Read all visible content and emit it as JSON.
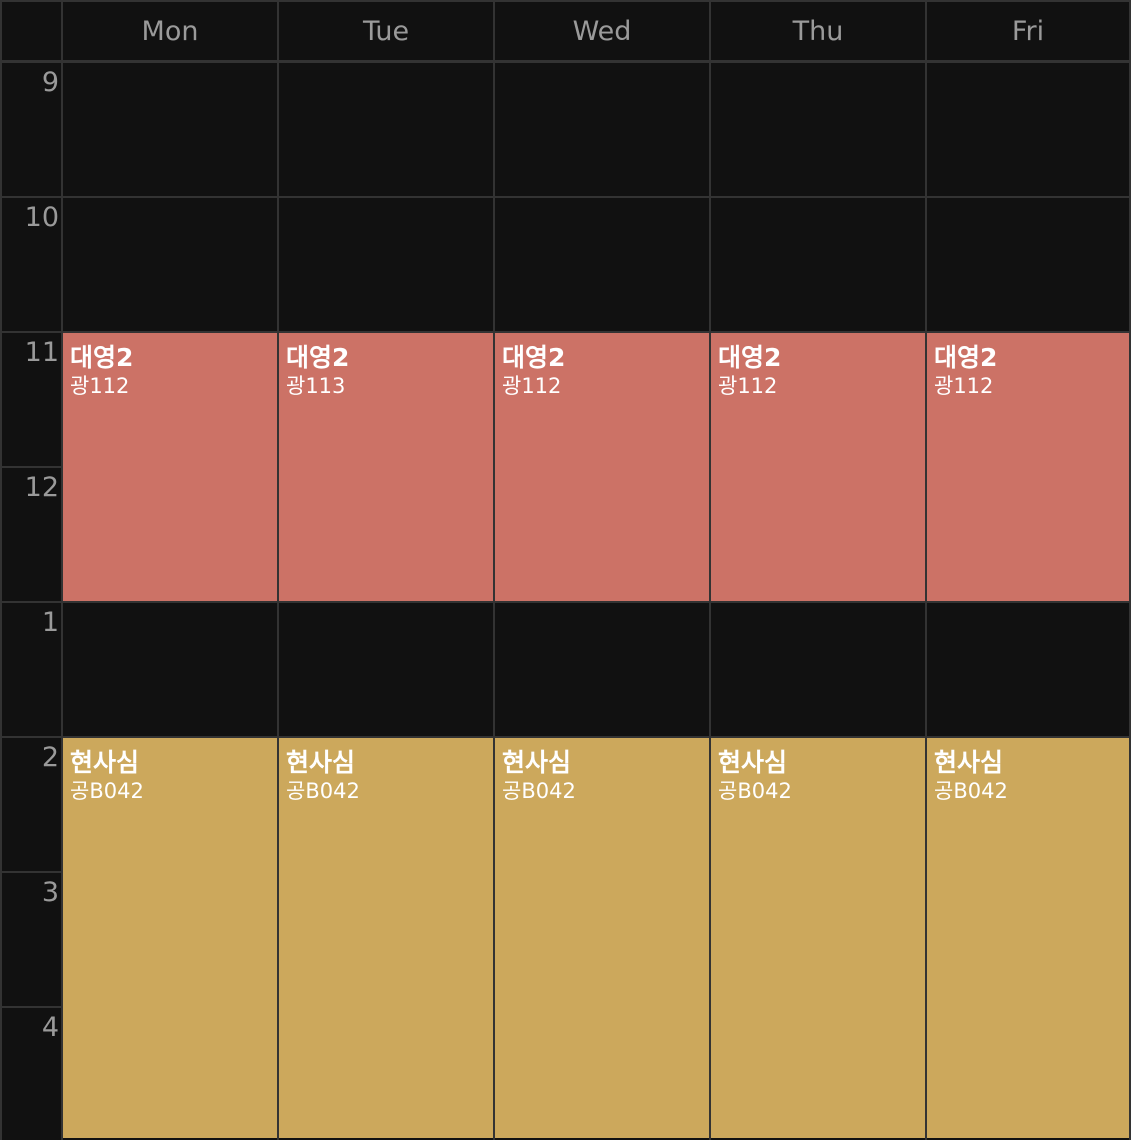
{
  "days": [
    "Mon",
    "Tue",
    "Wed",
    "Thu",
    "Fri"
  ],
  "hours": [
    "9",
    "10",
    "11",
    "12",
    "1",
    "2",
    "3",
    "4"
  ],
  "colors": {
    "background": "#111111",
    "grid_line": "#333333",
    "label_text": "#9a9a9a",
    "event_red": "#cc7266",
    "event_gold": "#cca85c"
  },
  "events": [
    {
      "day": 0,
      "start_hour_index": 2,
      "hours": 2,
      "title": "대영2",
      "room": "광112",
      "color": "#cc7266"
    },
    {
      "day": 1,
      "start_hour_index": 2,
      "hours": 2,
      "title": "대영2",
      "room": "광113",
      "color": "#cc7266"
    },
    {
      "day": 2,
      "start_hour_index": 2,
      "hours": 2,
      "title": "대영2",
      "room": "광112",
      "color": "#cc7266"
    },
    {
      "day": 3,
      "start_hour_index": 2,
      "hours": 2,
      "title": "대영2",
      "room": "광112",
      "color": "#cc7266"
    },
    {
      "day": 4,
      "start_hour_index": 2,
      "hours": 2,
      "title": "대영2",
      "room": "광112",
      "color": "#cc7266"
    },
    {
      "day": 0,
      "start_hour_index": 5,
      "hours": 3,
      "title": "현사심",
      "room": "공B042",
      "color": "#cca85c"
    },
    {
      "day": 1,
      "start_hour_index": 5,
      "hours": 3,
      "title": "현사심",
      "room": "공B042",
      "color": "#cca85c"
    },
    {
      "day": 2,
      "start_hour_index": 5,
      "hours": 3,
      "title": "현사심",
      "room": "공B042",
      "color": "#cca85c"
    },
    {
      "day": 3,
      "start_hour_index": 5,
      "hours": 3,
      "title": "현사심",
      "room": "공B042",
      "color": "#cca85c"
    },
    {
      "day": 4,
      "start_hour_index": 5,
      "hours": 3,
      "title": "현사심",
      "room": "공B042",
      "color": "#cca85c"
    }
  ]
}
